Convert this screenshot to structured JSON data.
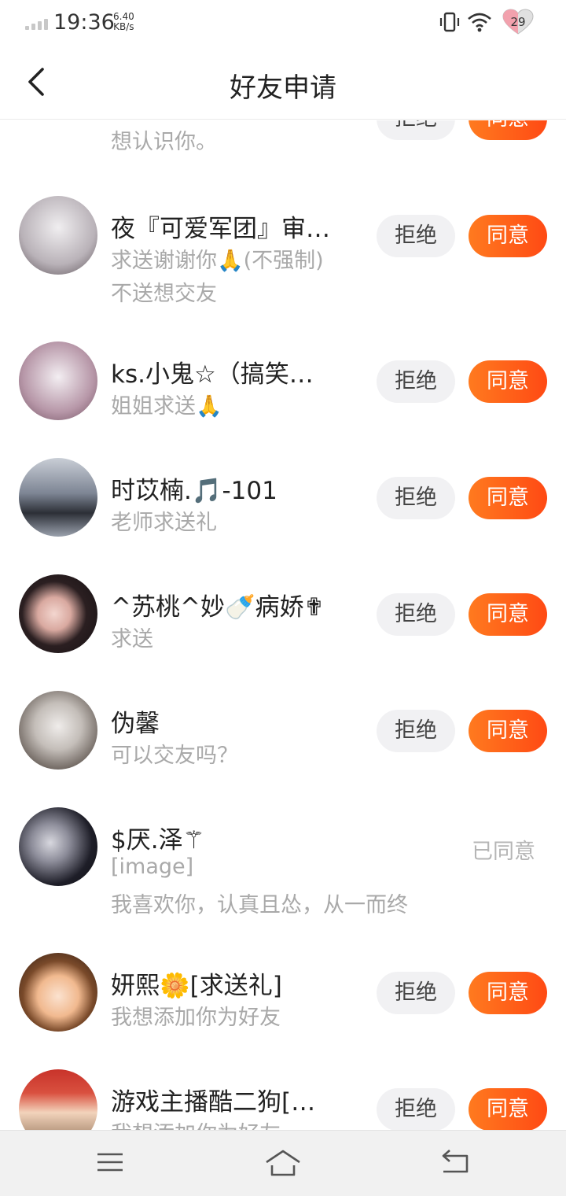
{
  "status": {
    "time": "19:36",
    "speed_value": "6.40",
    "speed_unit": "KB/s",
    "battery": "29"
  },
  "header": {
    "title": "好友申请",
    "back_icon": "back-arrow-icon"
  },
  "actions": {
    "reject": "拒绝",
    "accept": "同意",
    "accepted": "已同意"
  },
  "requests": [
    {
      "name": "",
      "lines": [
        "想认识你。"
      ],
      "status": "pending",
      "avatar_color": "#222222"
    },
    {
      "name": "夜『可爱军团』审…",
      "lines": [
        "求送谢谢你🙏(不强制)",
        "不送想交友"
      ],
      "status": "pending",
      "avatar_color": "#d9d2d6"
    },
    {
      "name": "ks.小鬼☆（搞笑…",
      "lines": [
        "姐姐求送🙏"
      ],
      "status": "pending",
      "avatar_color": "#c9b3bd"
    },
    {
      "name": "时苡楠.🎵-101",
      "lines": [
        "老师求送礼"
      ],
      "status": "pending",
      "avatar_color": "#8b8f99"
    },
    {
      "name": "^苏桃^妙🍼病娇✟",
      "lines": [
        "求送"
      ],
      "status": "pending",
      "avatar_color": "#3b2a2a"
    },
    {
      "name": "伪馨",
      "lines": [
        "可以交友吗？"
      ],
      "status": "pending",
      "avatar_color": "#bdbab8"
    },
    {
      "name": "$厌.泽⚚",
      "lines": [
        "[image]",
        "我喜欢你，认真且怂，从一而终"
      ],
      "status": "accepted",
      "avatar_color": "#2a2a33"
    },
    {
      "name": "妍熙🌼[求送礼]",
      "lines": [
        "我想添加你为好友"
      ],
      "status": "pending",
      "avatar_color": "#f2c6a8"
    },
    {
      "name": "游戏主播酷二狗[…",
      "lines": [
        "我想添加你为好友"
      ],
      "status": "pending",
      "avatar_color": "#c84a3a"
    }
  ],
  "nav": {
    "menu_icon": "menu-icon",
    "home_icon": "home-icon",
    "back_icon": "back-nav-icon"
  }
}
